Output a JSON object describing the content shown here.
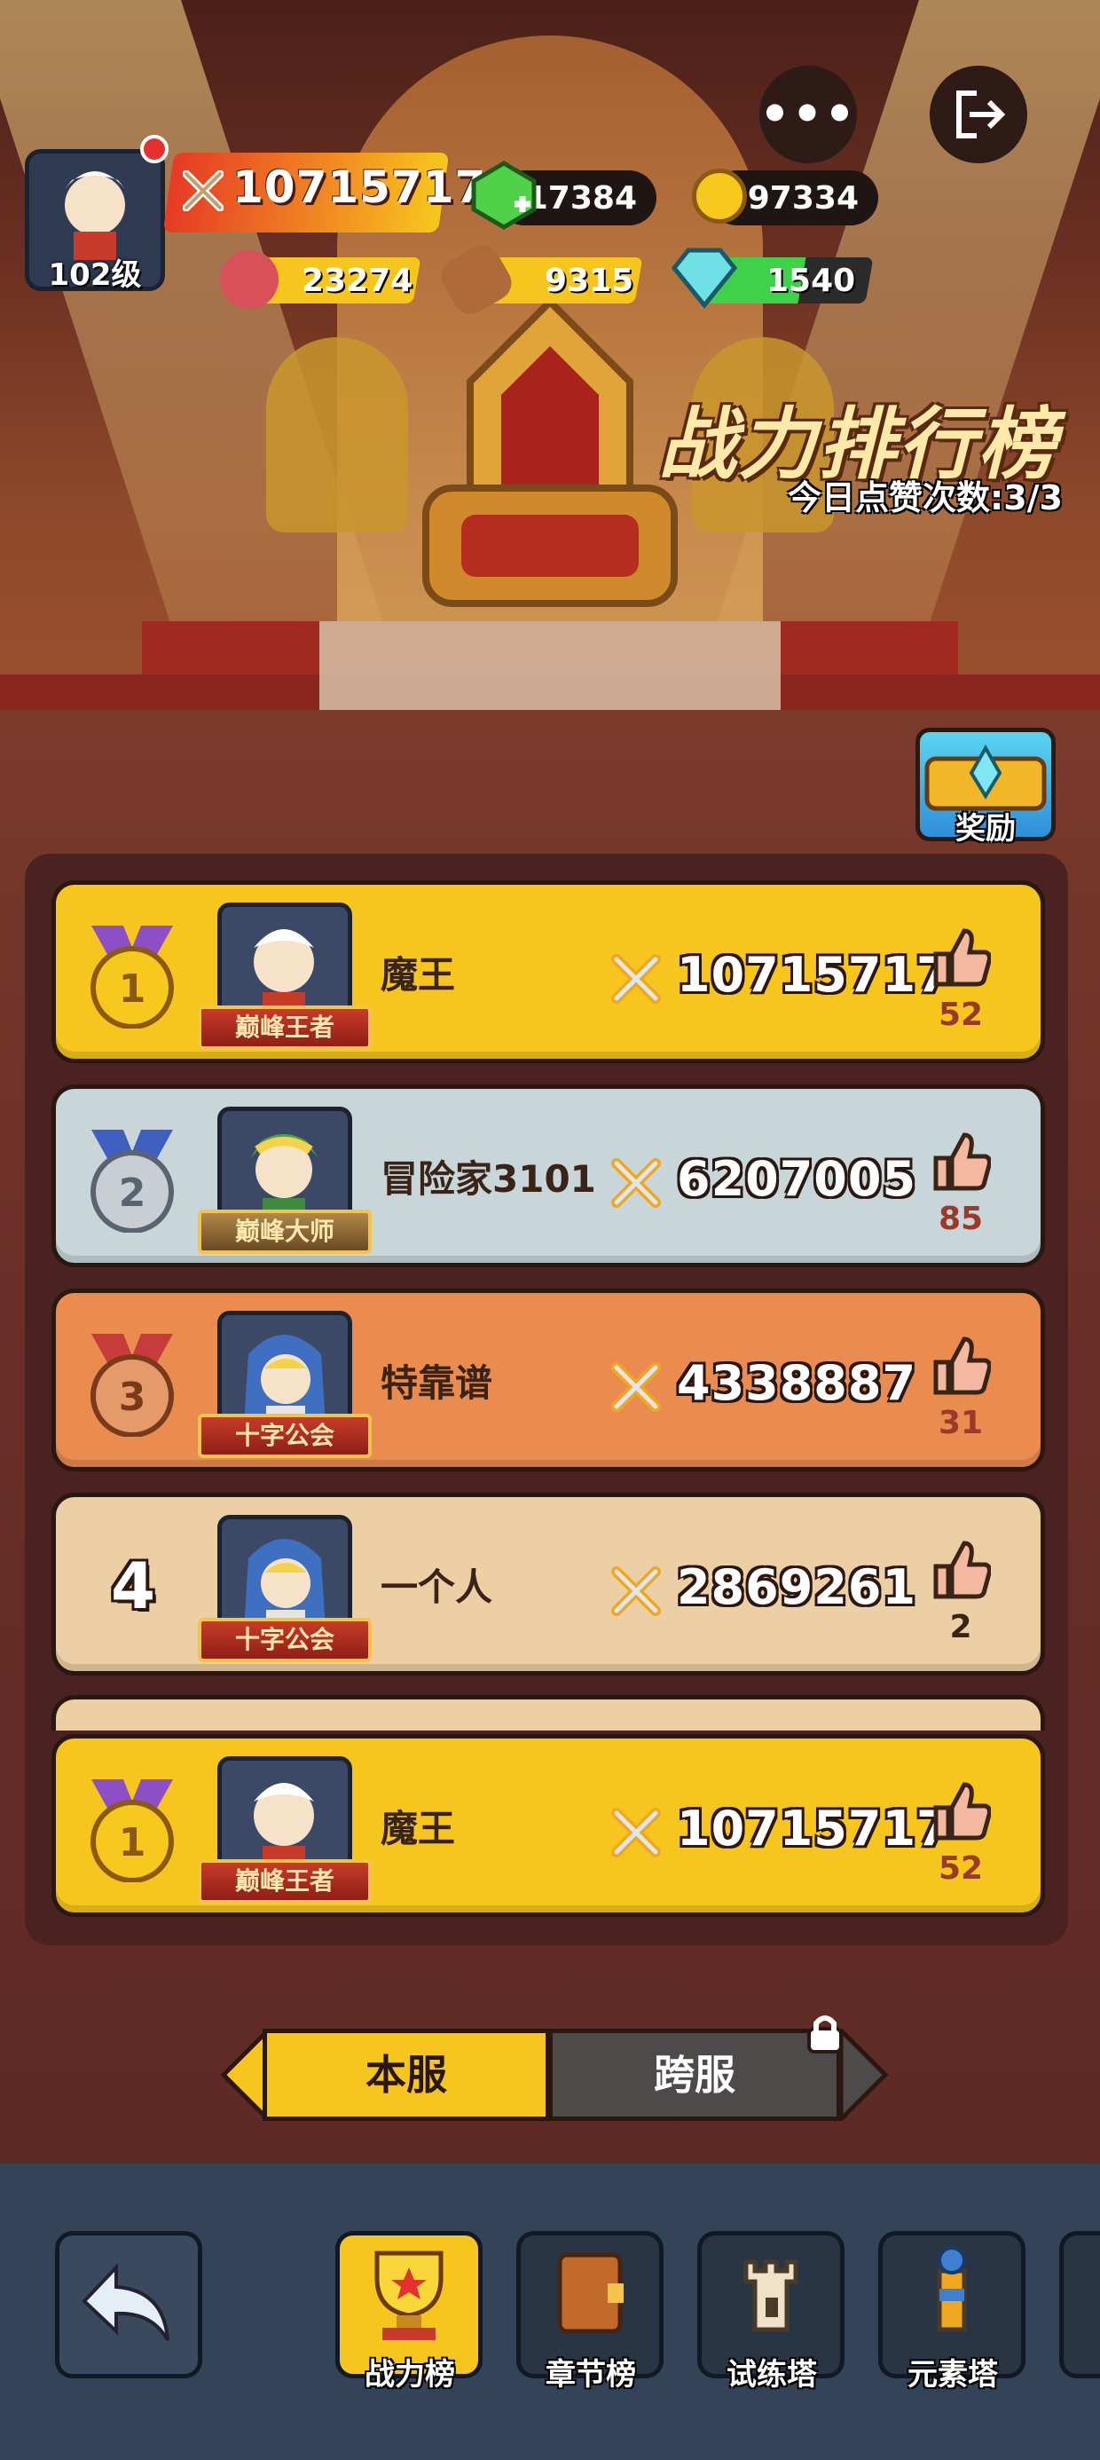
{
  "header": {
    "player_level": "102级",
    "power": "10715717",
    "gems": "17384",
    "coins": "697334",
    "meat": "23274",
    "wood": "9315",
    "crystal": "1540"
  },
  "title": "战力排行榜",
  "likes_today": "今日点赞次数:3/3",
  "reward_label": "奖励",
  "ranking": [
    {
      "rank": "1",
      "name": "魔王",
      "title": "巅峰王者",
      "power": "10715717",
      "likes": "52",
      "color": "#f6c51e"
    },
    {
      "rank": "2",
      "name": "冒险家3101",
      "title": "巅峰大师",
      "power": "6207005",
      "likes": "85",
      "color": "#c8d6da"
    },
    {
      "rank": "3",
      "name": "特靠谱",
      "title": "十字公会",
      "power": "4338887",
      "likes": "31",
      "color": "#ea8c50"
    },
    {
      "rank": "4",
      "name": "一个人",
      "title": "十字公会",
      "power": "2869261",
      "likes": "2",
      "color": "#edcfa6"
    }
  ],
  "my_rank": {
    "rank": "1",
    "name": "魔王",
    "title": "巅峰王者",
    "power": "10715717",
    "likes": "52"
  },
  "toggle": {
    "local": "本服",
    "cross": "跨服"
  },
  "nav": {
    "rank_power": "战力榜",
    "rank_chapter": "章节榜",
    "trial_tower": "试练塔",
    "element_tower": "元素塔"
  },
  "icons": [
    "back-icon",
    "more-icon",
    "exit-icon",
    "swords-icon",
    "gem-icon",
    "coin-icon",
    "meat-icon",
    "wood-icon",
    "crystal-icon",
    "thumb-up-icon",
    "lock-icon",
    "trophy-icon",
    "book-icon",
    "tower-icon",
    "element-tower-icon",
    "chest-icon",
    "medal-icon"
  ]
}
